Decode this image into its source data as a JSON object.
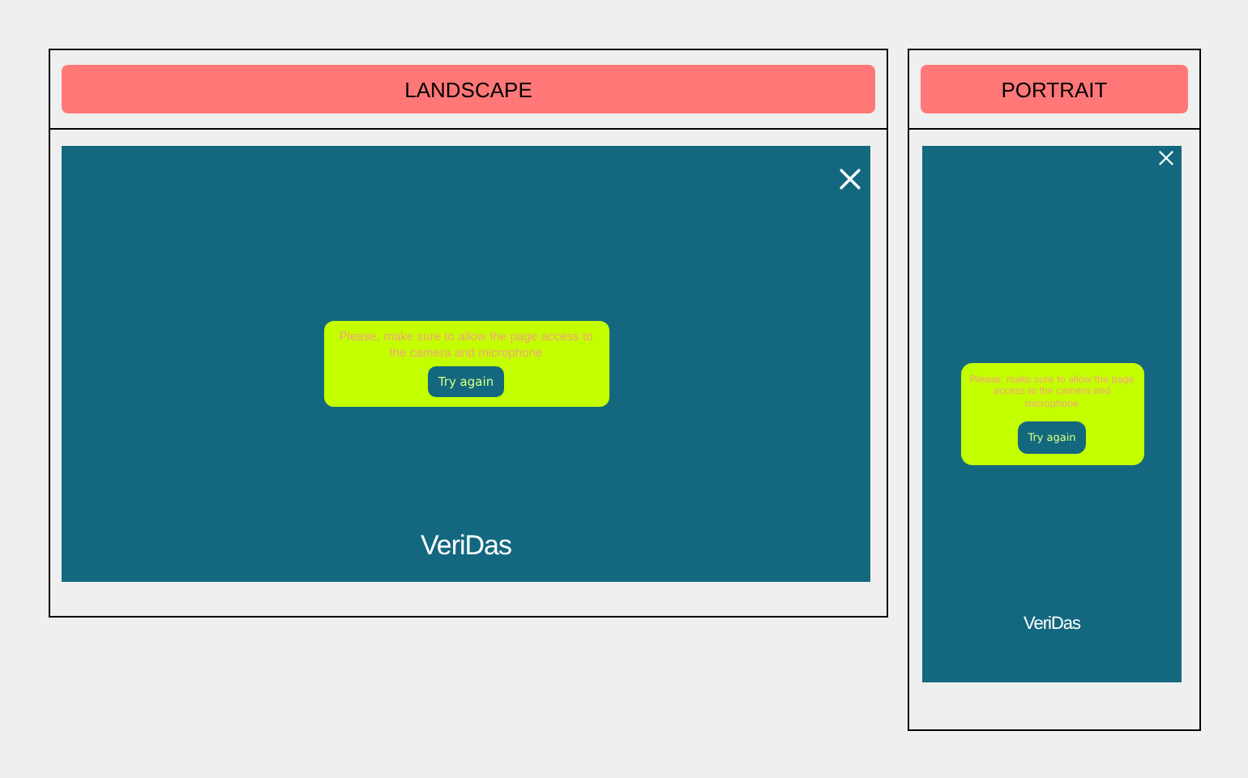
{
  "frames": [
    {
      "kind": "landscape",
      "label": "LANDSCAPE",
      "message": "Please, make sure to allow the page access to the camera and microphone",
      "button": "Try again",
      "logo": "VeriDas"
    },
    {
      "kind": "portrait",
      "label": "PORTRAIT",
      "message": "Please, make sure to allow the page access to the camera and microphone",
      "button": "Try again",
      "logo": "VeriDas"
    }
  ]
}
